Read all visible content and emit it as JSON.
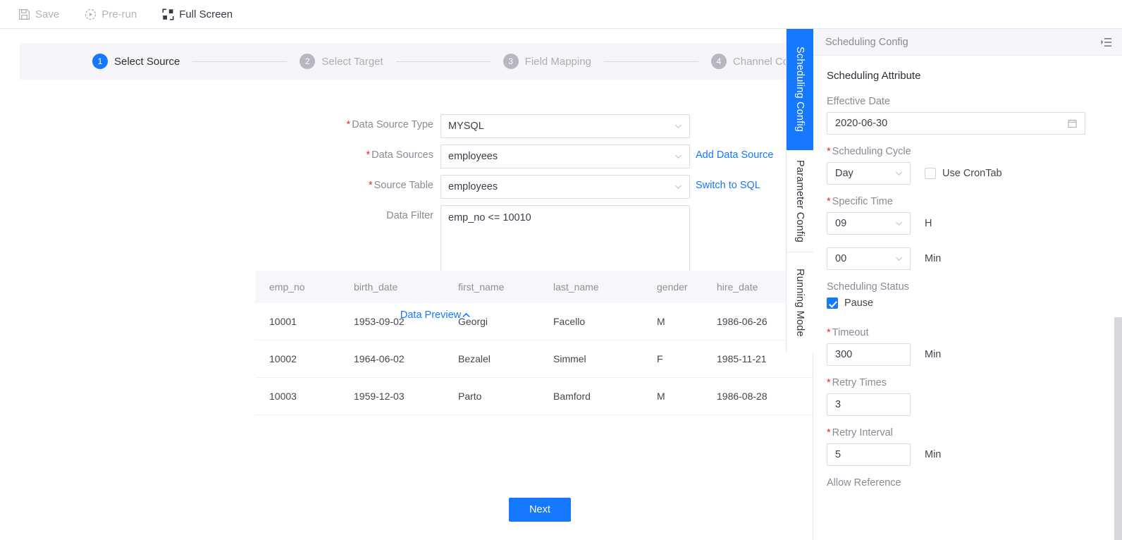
{
  "toolbar": {
    "items": [
      {
        "label": "Save",
        "icon": "save-icon",
        "state": "disabled"
      },
      {
        "label": "Pre-run",
        "icon": "play-circle-icon",
        "state": "disabled"
      },
      {
        "label": "Full Screen",
        "icon": "fullscreen-icon",
        "state": "active"
      }
    ]
  },
  "stepper": {
    "steps": [
      {
        "num": "1",
        "label": "Select Source"
      },
      {
        "num": "2",
        "label": "Select Target"
      },
      {
        "num": "3",
        "label": "Field Mapping"
      },
      {
        "num": "4",
        "label": "Channel Control"
      }
    ],
    "active_index": 0
  },
  "form": {
    "data_source_type": {
      "label": "Data Source Type",
      "required": true,
      "value": "MYSQL"
    },
    "data_sources": {
      "label": "Data Sources",
      "required": true,
      "value": "employees",
      "link": "Add Data Source"
    },
    "source_table": {
      "label": "Source Table",
      "required": true,
      "value": "employees",
      "link": "Switch to SQL"
    },
    "data_filter": {
      "label": "Data Filter",
      "required": false,
      "value": "emp_no <= 10010"
    },
    "preview_toggle": "Data Preview",
    "next_button": "Next"
  },
  "preview_table": {
    "columns": [
      "emp_no",
      "birth_date",
      "first_name",
      "last_name",
      "gender",
      "hire_date"
    ],
    "rows": [
      [
        "10001",
        "1953-09-02",
        "Georgi",
        "Facello",
        "M",
        "1986-06-26"
      ],
      [
        "10002",
        "1964-06-02",
        "Bezalel",
        "Simmel",
        "F",
        "1985-11-21"
      ],
      [
        "10003",
        "1959-12-03",
        "Parto",
        "Bamford",
        "M",
        "1986-08-28"
      ]
    ]
  },
  "rail": {
    "tabs": [
      {
        "label": "Scheduling Config",
        "active": true
      },
      {
        "label": "Parameter Config",
        "active": false
      },
      {
        "label": "Running Mode",
        "active": false
      }
    ]
  },
  "panel": {
    "title": "Scheduling Config",
    "section_title": "Scheduling Attribute",
    "effective_date": {
      "label": "Effective Date",
      "required": false,
      "value": "2020-06-30"
    },
    "scheduling_cycle": {
      "label": "Scheduling Cycle",
      "required": true,
      "value": "Day"
    },
    "use_crontab": {
      "label": "Use CronTab",
      "checked": false
    },
    "specific_time": {
      "label": "Specific Time",
      "required": true,
      "hour": "09",
      "hour_unit": "H",
      "minute": "00",
      "minute_unit": "Min"
    },
    "scheduling_status": {
      "label": "Scheduling Status"
    },
    "pause": {
      "label": "Pause",
      "checked": true
    },
    "timeout": {
      "label": "Timeout",
      "required": true,
      "value": "300",
      "unit": "Min"
    },
    "retry_times": {
      "label": "Retry Times",
      "required": true,
      "value": "3"
    },
    "retry_interval": {
      "label": "Retry Interval",
      "required": true,
      "value": "5",
      "unit": "Min"
    },
    "allow_reference": {
      "label": "Allow Reference"
    }
  },
  "colors": {
    "accent": "#1677ff",
    "required": "#f5222d",
    "header_bg": "#f5f5fa"
  }
}
